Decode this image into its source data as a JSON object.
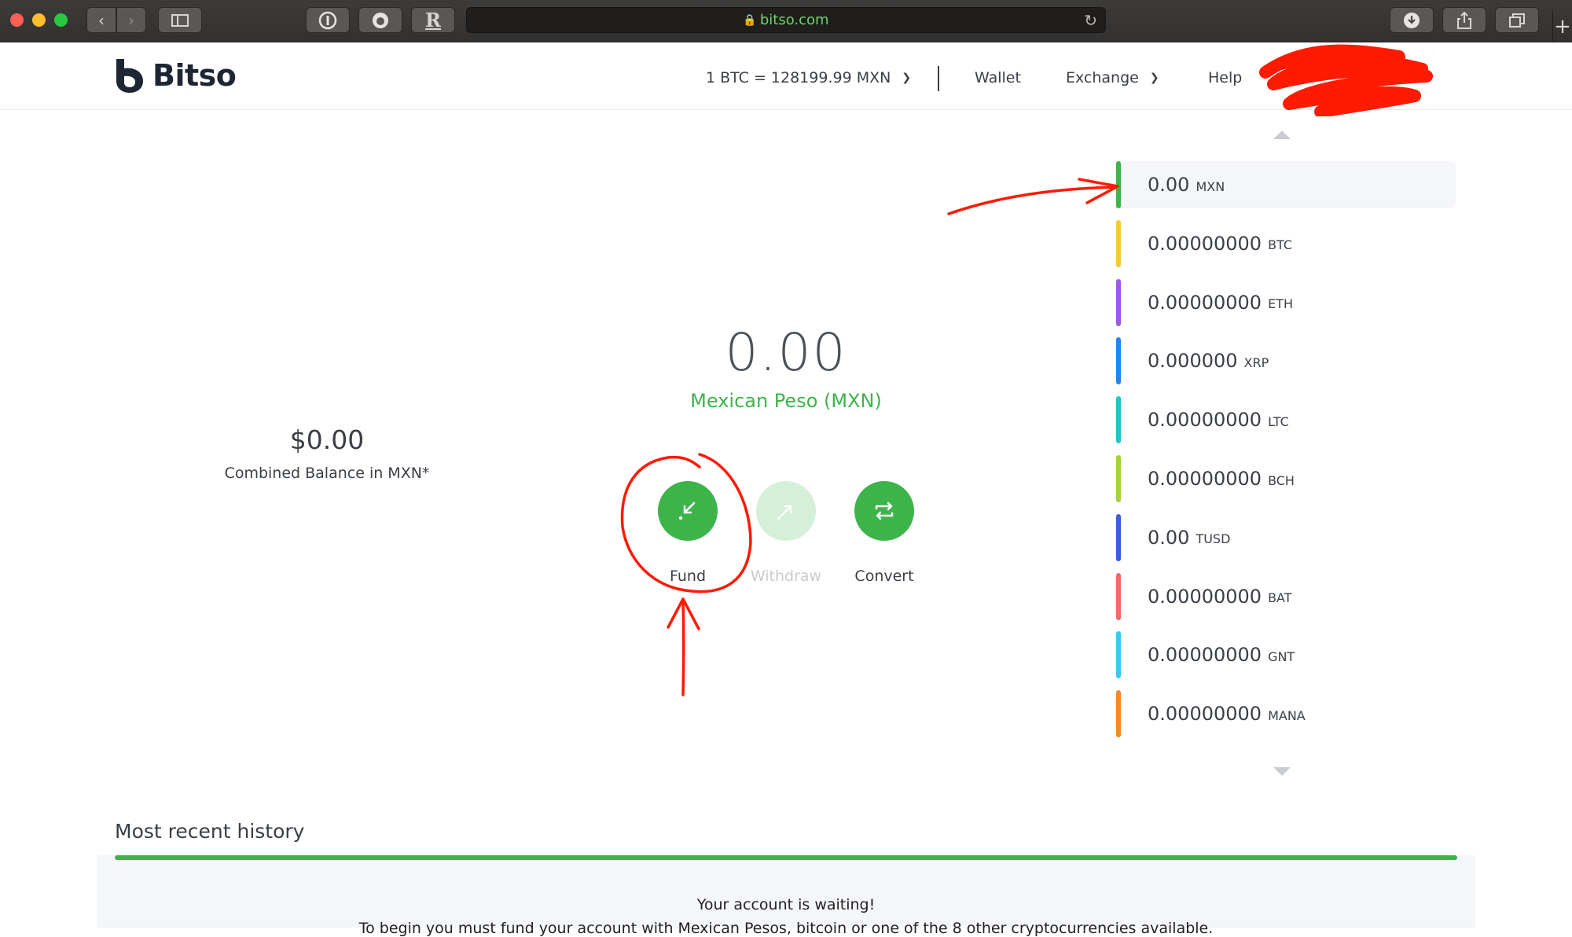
{
  "browser": {
    "url": "bitso.com"
  },
  "nav": {
    "logo_text": "Bitso",
    "rate": "1 BTC = 128199.99 MXN",
    "wallet": "Wallet",
    "exchange": "Exchange",
    "help": "Help"
  },
  "combined": {
    "amount": "$0.00",
    "label": "Combined Balance in MXN*"
  },
  "selected": {
    "amount": "0.00",
    "currency": "Mexican Peso (MXN)"
  },
  "actions": {
    "fund": "Fund",
    "withdraw": "Withdraw",
    "convert": "Convert"
  },
  "coins": [
    {
      "amount": "0.00",
      "code": "MXN",
      "color": "#3db44a"
    },
    {
      "amount": "0.00000000",
      "code": "BTC",
      "color": "#f5c937"
    },
    {
      "amount": "0.00000000",
      "code": "ETH",
      "color": "#9b59e8"
    },
    {
      "amount": "0.000000",
      "code": "XRP",
      "color": "#1f86f0"
    },
    {
      "amount": "0.00000000",
      "code": "LTC",
      "color": "#26c4c4"
    },
    {
      "amount": "0.00000000",
      "code": "BCH",
      "color": "#a5d33c"
    },
    {
      "amount": "0.00",
      "code": "TUSD",
      "color": "#3d5bdb"
    },
    {
      "amount": "0.00000000",
      "code": "BAT",
      "color": "#f06a6a"
    },
    {
      "amount": "0.00000000",
      "code": "GNT",
      "color": "#3cc6f0"
    },
    {
      "amount": "0.00000000",
      "code": "MANA",
      "color": "#f5892a"
    }
  ],
  "history": {
    "title": "Most recent history",
    "message": "Your account is waiting!",
    "sub": "To begin you must fund your account with Mexican Pesos, bitcoin or one of the 8 other cryptocurrencies available."
  },
  "colors": {
    "accent": "#3db44a",
    "annotation": "#ff1a00"
  }
}
